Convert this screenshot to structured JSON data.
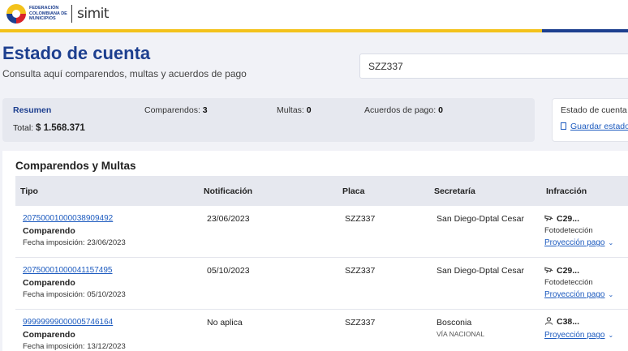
{
  "logo": {
    "org_text": "FEDERACIÓN COLOMBIANA DE MUNICIPIOS",
    "brand": "simit"
  },
  "colors": {
    "brand_blue": "#1d3f8f",
    "brand_yellow": "#f3c21b",
    "link": "#1d5bbf"
  },
  "header": {
    "title": "Estado de cuenta",
    "subtitle": "Consulta aquí comparendos, multas y acuerdos de pago"
  },
  "search": {
    "value": "SZZ337"
  },
  "summary": {
    "heading": "Resumen",
    "total_label": "Total:",
    "total_value": "$ 1.568.371",
    "comparendos_label": "Comparendos:",
    "comparendos_value": "3",
    "multas_label": "Multas:",
    "multas_value": "0",
    "acuerdos_label": "Acuerdos de pago:",
    "acuerdos_value": "0"
  },
  "status_card": {
    "title": "Estado de cuenta",
    "save_link": "Guardar estado",
    "icon": "document-icon"
  },
  "table": {
    "title": "Comparendos y Multas",
    "columns": [
      "Tipo",
      "Notificación",
      "Placa",
      "Secretaría",
      "Infracción"
    ],
    "rows": [
      {
        "number": "20750001000038909492",
        "type": "Comparendo",
        "date": "Fecha imposición: 23/06/2023",
        "notification": "23/06/2023",
        "plate": "SZZ337",
        "secretaria": "San Diego-Dptal Cesar",
        "secretaria_sub": "",
        "infraction_icon": "camera-icon",
        "infraction": "C29...",
        "detection": "Fotodetección",
        "projection": "Proyección pago"
      },
      {
        "number": "20750001000041157495",
        "type": "Comparendo",
        "date": "Fecha imposición: 05/10/2023",
        "notification": "05/10/2023",
        "plate": "SZZ337",
        "secretaria": "San Diego-Dptal Cesar",
        "secretaria_sub": "",
        "infraction_icon": "camera-icon",
        "infraction": "C29...",
        "detection": "Fotodetección",
        "projection": "Proyección pago"
      },
      {
        "number": "99999999000005746164",
        "type": "Comparendo",
        "date": "Fecha imposición: 13/12/2023",
        "notification": "No aplica",
        "plate": "SZZ337",
        "secretaria": "Bosconia",
        "secretaria_sub": "VÍA NACIONAL",
        "infraction_icon": "person-icon",
        "infraction": "C38...",
        "detection": "",
        "projection": "Proyección pago"
      }
    ]
  }
}
